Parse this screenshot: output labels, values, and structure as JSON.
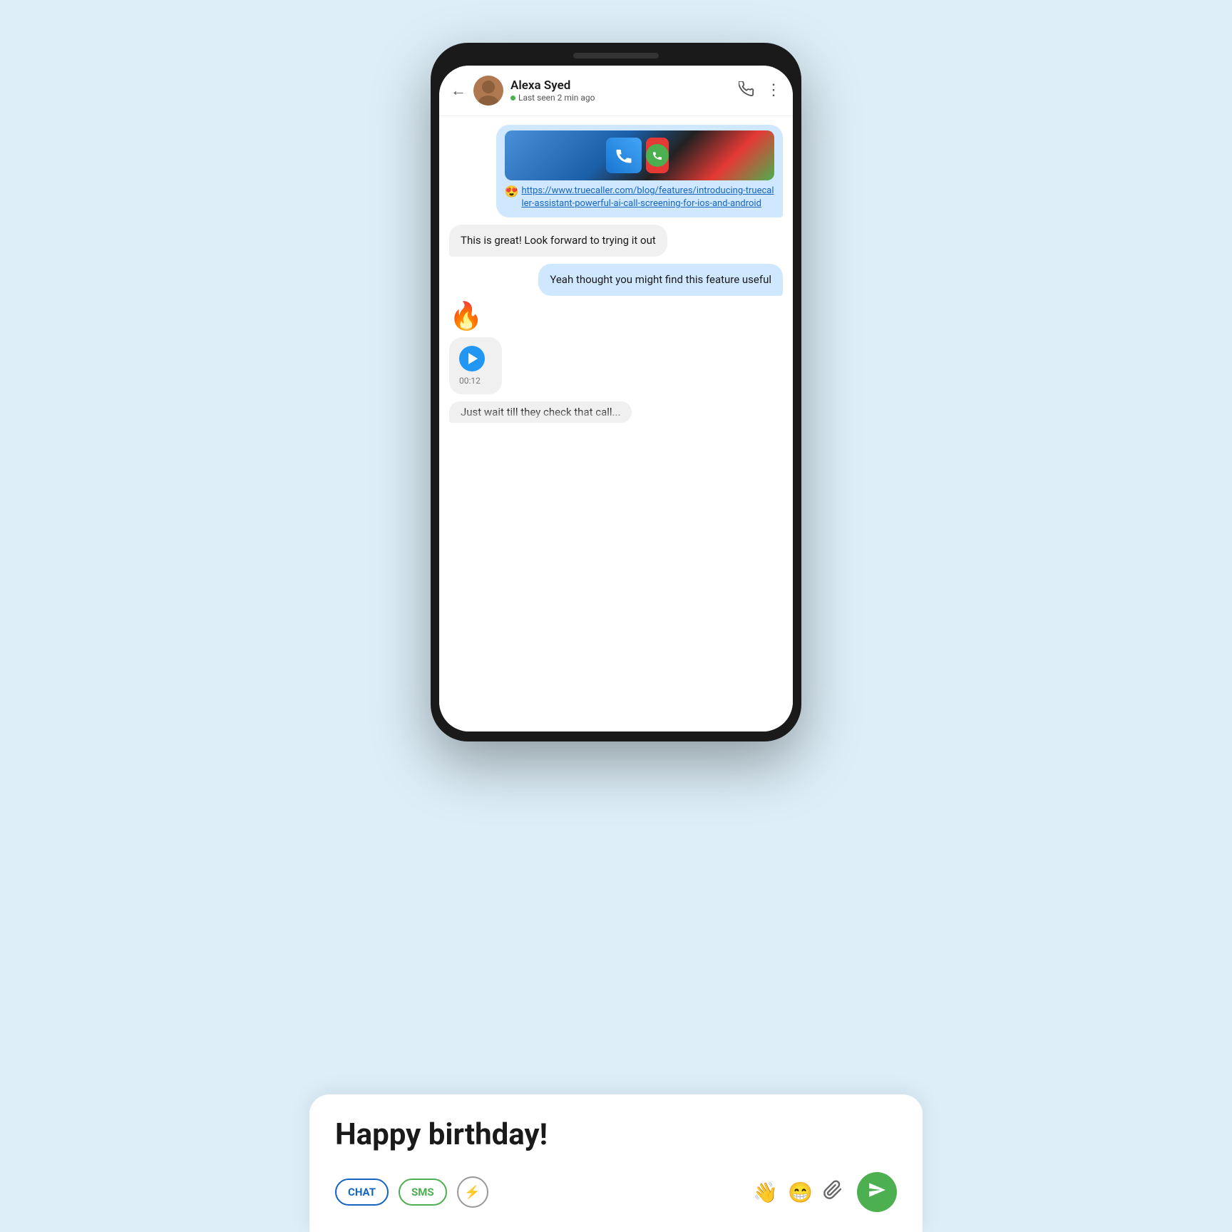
{
  "background_color": "#ddeef8",
  "phone": {
    "header": {
      "contact_name": "Alexa Syed",
      "status": "Last seen 2 min ago",
      "back_label": "←",
      "call_icon": "📞",
      "more_icon": "⋮"
    },
    "messages": [
      {
        "id": "msg1",
        "type": "link_bubble",
        "direction": "sent",
        "link_url": "https://www.truecaller.com/blog/features/introducing-truecaller-assistant-powerful-ai-call-screening-for-ios-and-android",
        "emoji_reaction": "😍"
      },
      {
        "id": "msg2",
        "type": "text",
        "direction": "received",
        "text": "This is great! Look forward to trying it out"
      },
      {
        "id": "msg3",
        "type": "text",
        "direction": "sent",
        "text": "Yeah thought you might find this feature useful"
      },
      {
        "id": "msg4",
        "type": "emoji",
        "direction": "received",
        "text": "🔥"
      },
      {
        "id": "msg5",
        "type": "voice",
        "direction": "received",
        "duration": "00:12"
      },
      {
        "id": "msg6",
        "type": "partial",
        "direction": "received",
        "text": "Just wait till they check that call..."
      }
    ]
  },
  "bottom_card": {
    "message_text": "Happy birthday!",
    "tabs": [
      {
        "label": "CHAT",
        "type": "chat"
      },
      {
        "label": "SMS",
        "type": "sms"
      }
    ],
    "flash_icon": "⚡",
    "wave_icon": "👋",
    "emoji_icon": "😁",
    "clip_icon": "📎",
    "send_icon": "➤"
  }
}
